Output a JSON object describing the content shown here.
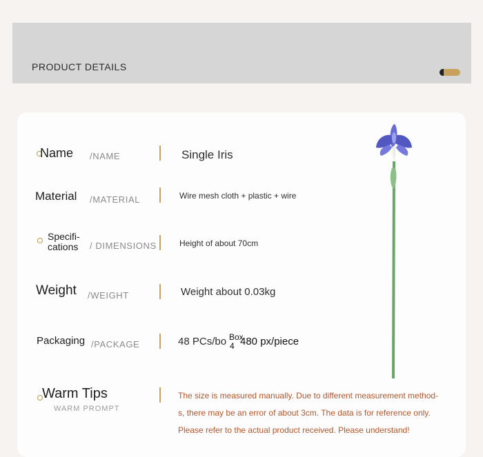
{
  "header": {
    "title": "PRODUCT DETAILS"
  },
  "rows": [
    {
      "label": "Name",
      "sub": "/NAME",
      "value": "Single Iris"
    },
    {
      "label": "Material",
      "sub": "/MATERIAL",
      "value": "Wire mesh cloth + plastic + wire"
    },
    {
      "label_line1": "Specifi-",
      "label_line2": "cations",
      "sub": "/ DIMENSIONS",
      "value": "Height of about 70cm"
    },
    {
      "label": "Weight",
      "sub": "/WEIGHT",
      "value": "Weight about 0.03kg"
    },
    {
      "label": "Packaging",
      "sub": "/PACKAGE",
      "value_a": "48 PCs/bo",
      "value_box": "Box",
      "value_num": "4",
      "value_b": "480 px/piece"
    }
  ],
  "warm": {
    "label": "Warm Tips",
    "sub": "WARM PROMPT",
    "lines": [
      "The size is measured manually. Due to different measurement method-",
      "s, there may be an error of about 3cm. The data is for reference only.",
      "Please refer to the actual product received. Please understand!"
    ]
  },
  "colors": {
    "accent_gold": "#c8a060",
    "tips_text": "#b2552a",
    "petal": "#5b5fc4",
    "stem": "#6aa56a"
  },
  "image": {
    "subject": "flower-iris"
  }
}
